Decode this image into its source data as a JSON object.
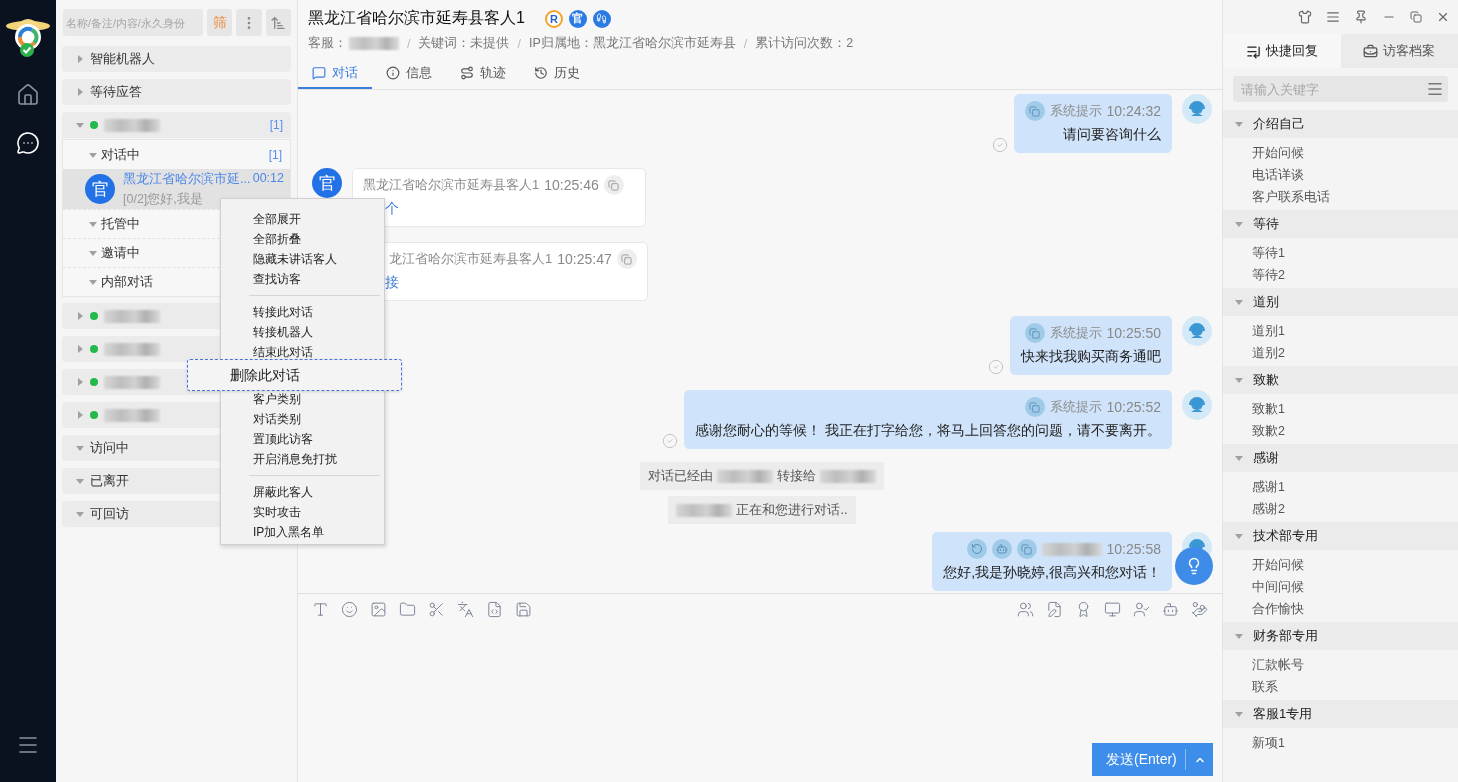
{
  "rail": {
    "items": [
      {
        "selected": false
      },
      {
        "selected": true
      }
    ]
  },
  "sidebar": {
    "search": {
      "placeholder": "名称/备注/内容/永久身份"
    },
    "filter_button": "筛",
    "groups": [
      {
        "kind": "section",
        "label": "智能机器人",
        "expanded": false
      },
      {
        "kind": "section",
        "label": "等待应答",
        "expanded": false
      },
      {
        "kind": "agent",
        "online": true,
        "count": "[1]",
        "expanded": true,
        "subgroups": [
          {
            "label": "对话中",
            "count": "[1]",
            "expanded": true,
            "conversations": [
              {
                "avatar": "官",
                "name": "黑龙江省哈尔滨市延...",
                "time": "00:12",
                "preview": "[0/2]您好,我是",
                "selected": true
              }
            ]
          },
          {
            "label": "托管中",
            "expanded": true
          },
          {
            "label": "邀请中",
            "expanded": true
          },
          {
            "label": "内部对话",
            "expanded": true
          }
        ]
      },
      {
        "kind": "agent",
        "online": true,
        "expanded": false
      },
      {
        "kind": "agent",
        "online": true,
        "expanded": false
      },
      {
        "kind": "agent",
        "online": true,
        "expanded": false
      },
      {
        "kind": "agent",
        "online": true,
        "expanded": false
      },
      {
        "kind": "section",
        "label": "访问中",
        "expanded": true
      },
      {
        "kind": "section",
        "label": "已离开",
        "expanded": true
      },
      {
        "kind": "section",
        "label": "可回访",
        "expanded": true
      }
    ]
  },
  "context_menu": {
    "sections": [
      {
        "items": [
          {
            "label": "全部展开",
            "highlighted": false
          },
          {
            "label": "全部折叠",
            "highlighted": false
          },
          {
            "label": "隐藏未讲话客人",
            "highlighted": false
          },
          {
            "label": "查找访客",
            "highlighted": false
          }
        ]
      },
      {
        "items": [
          {
            "label": "转接此对话",
            "highlighted": false
          },
          {
            "label": "转接机器人",
            "highlighted": false
          },
          {
            "label": "结束此对话",
            "highlighted": false
          },
          {
            "label": "删除此对话",
            "highlighted": true
          },
          {
            "label": "客户类别",
            "highlighted": false
          },
          {
            "label": "对话类别",
            "highlighted": false
          },
          {
            "label": "置顶此访客",
            "highlighted": false
          },
          {
            "label": "开启消息免打扰",
            "highlighted": false
          }
        ]
      },
      {
        "items": [
          {
            "label": "屏蔽此客人",
            "highlighted": false
          },
          {
            "label": "实时攻击",
            "highlighted": false
          },
          {
            "label": "IP加入黑名单",
            "highlighted": false
          }
        ]
      }
    ]
  },
  "conversation": {
    "title": "黑龙江省哈尔滨市延寿县客人1",
    "badges": [
      {
        "kind": "ring",
        "text": "R"
      },
      {
        "kind": "solid",
        "text": "官"
      },
      {
        "kind": "footprint"
      }
    ],
    "meta": {
      "separator": "/",
      "items": [
        {
          "kind": "redacted",
          "label": "客服："
        },
        {
          "kind": "text",
          "text": "关键词：未提供"
        },
        {
          "kind": "text",
          "text": "IP归属地：黑龙江省哈尔滨市延寿县"
        },
        {
          "kind": "text",
          "text": "累计访问次数：2"
        }
      ]
    },
    "tabs": [
      {
        "label": "对话",
        "selected": true
      },
      {
        "label": "信息",
        "selected": false
      },
      {
        "label": "轨迹",
        "selected": false
      },
      {
        "label": "历史",
        "selected": false
      }
    ],
    "messages": [
      {
        "kind": "outgoing",
        "sender": "系统提示",
        "time": "10:24:32",
        "text": "请问要咨询什么",
        "read": true
      },
      {
        "kind": "incoming",
        "avatar": "官",
        "sender": "黑龙江省哈尔滨市延寿县客人1",
        "time": "10:25:46",
        "text": "个",
        "partly_hidden": false
      },
      {
        "kind": "incoming",
        "sender": "龙江省哈尔滨市延寿县客人1",
        "time": "10:25:47",
        "text": "接",
        "partly_hidden": true
      },
      {
        "kind": "outgoing",
        "sender": "系统提示",
        "time": "10:25:50",
        "text": "快来找我购买商务通吧",
        "read": true
      },
      {
        "kind": "outgoing",
        "sender": "系统提示",
        "time": "10:25:52",
        "text": "感谢您耐心的等候！ 我正在打字给您，将马上回答您的问题，请不要离开。",
        "read": true
      },
      {
        "kind": "notice",
        "segments": [
          {
            "kind": "text",
            "text": "对话已经由"
          },
          {
            "kind": "redacted"
          },
          {
            "kind": "text",
            "text": "转接给"
          },
          {
            "kind": "redacted"
          }
        ]
      },
      {
        "kind": "notice",
        "segments": [
          {
            "kind": "redacted"
          },
          {
            "kind": "text",
            "text": "正在和您进行对话.."
          }
        ]
      },
      {
        "kind": "outgoing",
        "time": "10:25:58",
        "text": "您好,我是孙晓婷,很高兴和您对话！",
        "read": false
      }
    ],
    "send_button": "发送(Enter)"
  },
  "quick_reply": {
    "tabs": [
      {
        "label": "快捷回复",
        "selected": true
      },
      {
        "label": "访客档案",
        "selected": false
      }
    ],
    "search": {
      "placeholder": "请输入关键字"
    },
    "groups": [
      {
        "label": "介绍自己",
        "expanded": true,
        "items": [
          "开始问候",
          "电话详谈",
          "客户联系电话"
        ]
      },
      {
        "label": "等待",
        "expanded": true,
        "items": [
          "等待1",
          "等待2"
        ]
      },
      {
        "label": "道别",
        "expanded": true,
        "items": [
          "道别1",
          "道别2"
        ]
      },
      {
        "label": "致歉",
        "expanded": true,
        "items": [
          "致歉1",
          "致歉2"
        ]
      },
      {
        "label": "感谢",
        "expanded": true,
        "items": [
          "感谢1",
          "感谢2"
        ]
      },
      {
        "label": "技术部专用",
        "expanded": true,
        "items": [
          "开始问候",
          "中间问候",
          "合作愉快"
        ]
      },
      {
        "label": "财务部专用",
        "expanded": true,
        "items": [
          "汇款帐号",
          "联系"
        ]
      },
      {
        "label": "客服1专用",
        "expanded": true,
        "items": [
          "新项1"
        ]
      }
    ]
  }
}
